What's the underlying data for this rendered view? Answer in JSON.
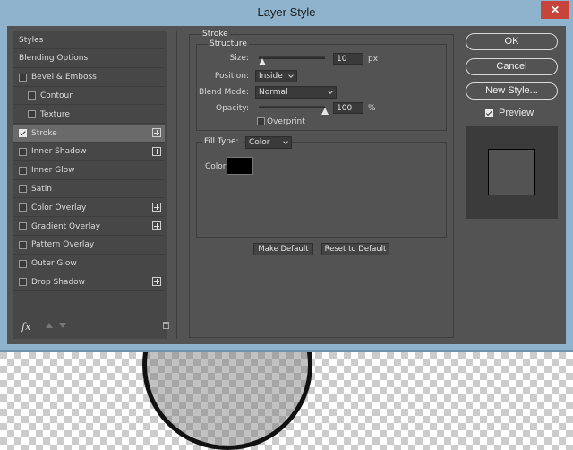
{
  "window": {
    "title": "Layer Style",
    "close_glyph": "✕"
  },
  "styles_list": [
    {
      "label": "Styles",
      "checkbox": false,
      "checked": false,
      "indent": 0,
      "plus": false,
      "selected": false
    },
    {
      "label": "Blending Options",
      "checkbox": false,
      "checked": false,
      "indent": 0,
      "plus": false,
      "selected": false
    },
    {
      "label": "Bevel & Emboss",
      "checkbox": true,
      "checked": false,
      "indent": 0,
      "plus": false,
      "selected": false
    },
    {
      "label": "Contour",
      "checkbox": true,
      "checked": false,
      "indent": 1,
      "plus": false,
      "selected": false
    },
    {
      "label": "Texture",
      "checkbox": true,
      "checked": false,
      "indent": 1,
      "plus": false,
      "selected": false
    },
    {
      "label": "Stroke",
      "checkbox": true,
      "checked": true,
      "indent": 0,
      "plus": true,
      "selected": true
    },
    {
      "label": "Inner Shadow",
      "checkbox": true,
      "checked": false,
      "indent": 0,
      "plus": true,
      "selected": false
    },
    {
      "label": "Inner Glow",
      "checkbox": true,
      "checked": false,
      "indent": 0,
      "plus": false,
      "selected": false
    },
    {
      "label": "Satin",
      "checkbox": true,
      "checked": false,
      "indent": 0,
      "plus": false,
      "selected": false
    },
    {
      "label": "Color Overlay",
      "checkbox": true,
      "checked": false,
      "indent": 0,
      "plus": true,
      "selected": false
    },
    {
      "label": "Gradient Overlay",
      "checkbox": true,
      "checked": false,
      "indent": 0,
      "plus": true,
      "selected": false
    },
    {
      "label": "Pattern Overlay",
      "checkbox": true,
      "checked": false,
      "indent": 0,
      "plus": false,
      "selected": false
    },
    {
      "label": "Outer Glow",
      "checkbox": true,
      "checked": false,
      "indent": 0,
      "plus": false,
      "selected": false
    },
    {
      "label": "Drop Shadow",
      "checkbox": true,
      "checked": false,
      "indent": 0,
      "plus": true,
      "selected": false
    }
  ],
  "bottom_tools": {
    "fx_label": "fx"
  },
  "stroke": {
    "section_title": "Stroke",
    "structure_title": "Structure",
    "size_label": "Size:",
    "size_value": "10",
    "size_unit": "px",
    "size_slider_fraction": 0.05,
    "position_label": "Position:",
    "position_value": "Inside",
    "blend_label": "Blend Mode:",
    "blend_value": "Normal",
    "opacity_label": "Opacity:",
    "opacity_value": "100",
    "opacity_unit": "%",
    "opacity_slider_fraction": 1.0,
    "overprint_label": "Overprint",
    "fill_type_label": "Fill Type:",
    "fill_type_value": "Color",
    "color_label": "Color:",
    "color_value": "#000000"
  },
  "actions": {
    "make_default": "Make Default",
    "reset_default": "Reset to Default",
    "ok": "OK",
    "cancel": "Cancel",
    "new_style": "New Style...",
    "preview": "Preview"
  }
}
